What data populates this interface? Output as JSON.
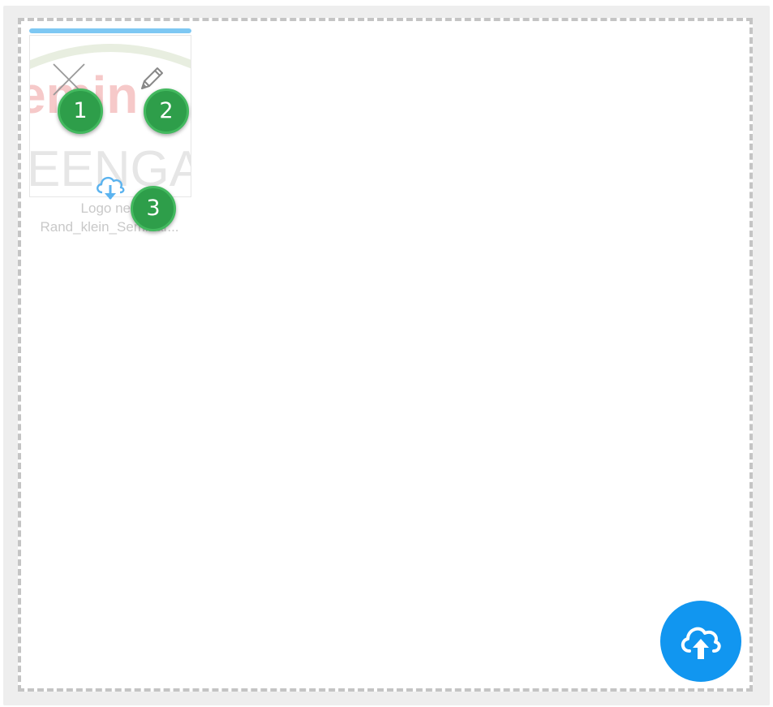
{
  "file_card": {
    "file_name_line1": "Logo neu",
    "file_name_line2": "Rand_klein_Seminar...",
    "progress_percent": 100,
    "thumbnail_text_top": "emin",
    "thumbnail_text_bottom": "EENGA"
  },
  "badges": {
    "badge_1": "1",
    "badge_2": "2",
    "badge_3": "3"
  },
  "icons": {
    "remove": "close-icon",
    "edit": "pencil-icon",
    "download": "cloud-download-icon",
    "upload": "cloud-upload-icon"
  },
  "colors": {
    "accent": "#1196f0",
    "progress": "#7ec8f3",
    "badge": "#2e9e4a",
    "dropzone_border": "#c4c4c4"
  }
}
